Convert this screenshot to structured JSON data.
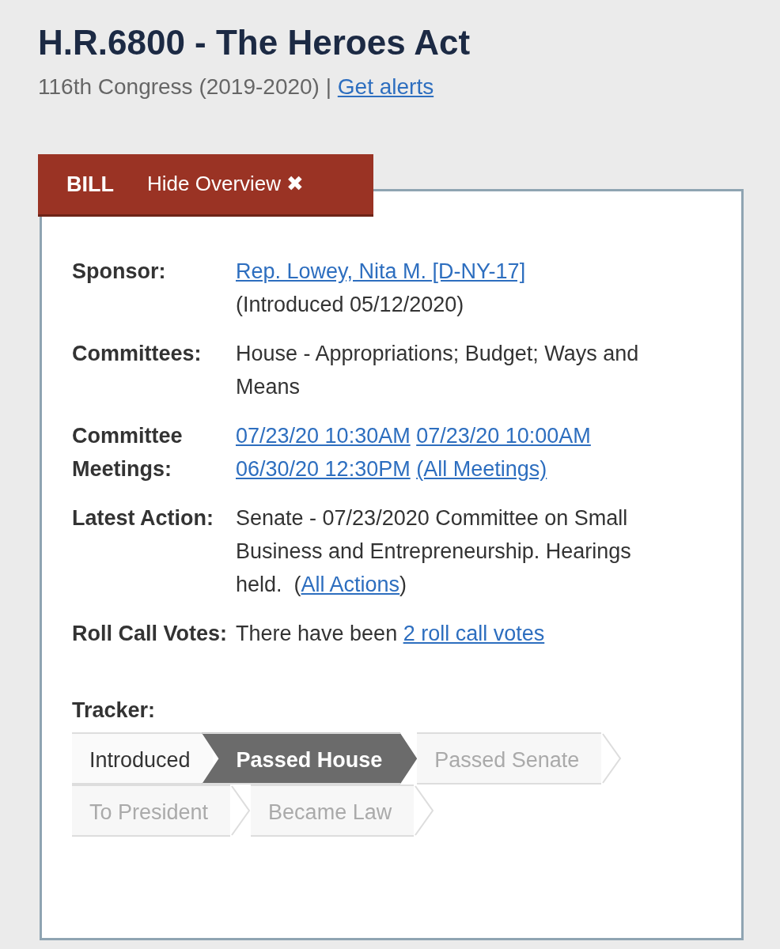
{
  "title": "H.R.6800 - The Heroes Act",
  "subtitle": {
    "text": "116th Congress (2019-2020) |",
    "link": "Get alerts"
  },
  "overview_tab": {
    "label": "BILL",
    "toggle": "Hide Overview",
    "toggle_icon": "✖"
  },
  "rows": [
    {
      "label": "Sponsor:",
      "paragraphs": [
        [
          {
            "kind": "link",
            "text": "Rep. Lowey, Nita M. [D-NY-17]"
          }
        ],
        [
          {
            "kind": "text",
            "text": "(Introduced 05/12/2020)"
          }
        ]
      ]
    },
    {
      "label": "Committees:",
      "paragraphs": [
        [
          {
            "kind": "text",
            "text": "House - Appropriations; Budget; Ways and Means"
          }
        ]
      ]
    },
    {
      "label": "Committee Meetings:",
      "paragraphs": [
        [
          {
            "kind": "link",
            "text": "07/23/20 10:30AM"
          },
          {
            "kind": "link",
            "text": "07/23/20 10:00AM"
          },
          {
            "kind": "link",
            "text": "06/30/20 12:30PM"
          },
          {
            "kind": "link",
            "text": "(All Meetings)"
          }
        ]
      ]
    },
    {
      "label": "Latest Action:",
      "paragraphs": [
        [
          {
            "kind": "text",
            "text": "Senate - 07/23/2020 Committee on Small Business and Entrepreneurship. Hearings held.  ("
          },
          {
            "kind": "link",
            "text": "All Actions"
          },
          {
            "kind": "text",
            "text": ")"
          }
        ]
      ]
    },
    {
      "label": "Roll Call Votes:",
      "paragraphs": [
        [
          {
            "kind": "text",
            "text": "There have been "
          },
          {
            "kind": "link",
            "text": "2 roll call votes"
          }
        ]
      ]
    }
  ],
  "tracker": {
    "label": "Tracker:",
    "steps": [
      {
        "label": "Introduced",
        "kind": "passed"
      },
      {
        "label": "Passed House",
        "kind": "current"
      },
      {
        "label": "Passed Senate",
        "kind": "pending"
      },
      {
        "label": "To President",
        "kind": "pending"
      },
      {
        "label": "Became Law",
        "kind": "pending"
      }
    ]
  }
}
